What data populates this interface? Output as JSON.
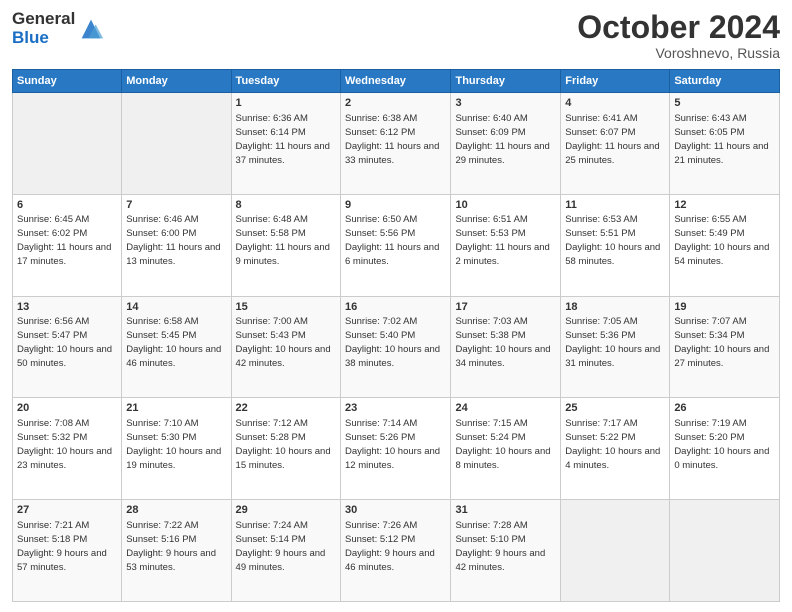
{
  "header": {
    "logo_line1": "General",
    "logo_line2": "Blue",
    "month": "October 2024",
    "location": "Voroshnevo, Russia"
  },
  "days_of_week": [
    "Sunday",
    "Monday",
    "Tuesday",
    "Wednesday",
    "Thursday",
    "Friday",
    "Saturday"
  ],
  "weeks": [
    [
      {
        "day": "",
        "sunrise": "",
        "sunset": "",
        "daylight": ""
      },
      {
        "day": "",
        "sunrise": "",
        "sunset": "",
        "daylight": ""
      },
      {
        "day": "1",
        "sunrise": "Sunrise: 6:36 AM",
        "sunset": "Sunset: 6:14 PM",
        "daylight": "Daylight: 11 hours and 37 minutes."
      },
      {
        "day": "2",
        "sunrise": "Sunrise: 6:38 AM",
        "sunset": "Sunset: 6:12 PM",
        "daylight": "Daylight: 11 hours and 33 minutes."
      },
      {
        "day": "3",
        "sunrise": "Sunrise: 6:40 AM",
        "sunset": "Sunset: 6:09 PM",
        "daylight": "Daylight: 11 hours and 29 minutes."
      },
      {
        "day": "4",
        "sunrise": "Sunrise: 6:41 AM",
        "sunset": "Sunset: 6:07 PM",
        "daylight": "Daylight: 11 hours and 25 minutes."
      },
      {
        "day": "5",
        "sunrise": "Sunrise: 6:43 AM",
        "sunset": "Sunset: 6:05 PM",
        "daylight": "Daylight: 11 hours and 21 minutes."
      }
    ],
    [
      {
        "day": "6",
        "sunrise": "Sunrise: 6:45 AM",
        "sunset": "Sunset: 6:02 PM",
        "daylight": "Daylight: 11 hours and 17 minutes."
      },
      {
        "day": "7",
        "sunrise": "Sunrise: 6:46 AM",
        "sunset": "Sunset: 6:00 PM",
        "daylight": "Daylight: 11 hours and 13 minutes."
      },
      {
        "day": "8",
        "sunrise": "Sunrise: 6:48 AM",
        "sunset": "Sunset: 5:58 PM",
        "daylight": "Daylight: 11 hours and 9 minutes."
      },
      {
        "day": "9",
        "sunrise": "Sunrise: 6:50 AM",
        "sunset": "Sunset: 5:56 PM",
        "daylight": "Daylight: 11 hours and 6 minutes."
      },
      {
        "day": "10",
        "sunrise": "Sunrise: 6:51 AM",
        "sunset": "Sunset: 5:53 PM",
        "daylight": "Daylight: 11 hours and 2 minutes."
      },
      {
        "day": "11",
        "sunrise": "Sunrise: 6:53 AM",
        "sunset": "Sunset: 5:51 PM",
        "daylight": "Daylight: 10 hours and 58 minutes."
      },
      {
        "day": "12",
        "sunrise": "Sunrise: 6:55 AM",
        "sunset": "Sunset: 5:49 PM",
        "daylight": "Daylight: 10 hours and 54 minutes."
      }
    ],
    [
      {
        "day": "13",
        "sunrise": "Sunrise: 6:56 AM",
        "sunset": "Sunset: 5:47 PM",
        "daylight": "Daylight: 10 hours and 50 minutes."
      },
      {
        "day": "14",
        "sunrise": "Sunrise: 6:58 AM",
        "sunset": "Sunset: 5:45 PM",
        "daylight": "Daylight: 10 hours and 46 minutes."
      },
      {
        "day": "15",
        "sunrise": "Sunrise: 7:00 AM",
        "sunset": "Sunset: 5:43 PM",
        "daylight": "Daylight: 10 hours and 42 minutes."
      },
      {
        "day": "16",
        "sunrise": "Sunrise: 7:02 AM",
        "sunset": "Sunset: 5:40 PM",
        "daylight": "Daylight: 10 hours and 38 minutes."
      },
      {
        "day": "17",
        "sunrise": "Sunrise: 7:03 AM",
        "sunset": "Sunset: 5:38 PM",
        "daylight": "Daylight: 10 hours and 34 minutes."
      },
      {
        "day": "18",
        "sunrise": "Sunrise: 7:05 AM",
        "sunset": "Sunset: 5:36 PM",
        "daylight": "Daylight: 10 hours and 31 minutes."
      },
      {
        "day": "19",
        "sunrise": "Sunrise: 7:07 AM",
        "sunset": "Sunset: 5:34 PM",
        "daylight": "Daylight: 10 hours and 27 minutes."
      }
    ],
    [
      {
        "day": "20",
        "sunrise": "Sunrise: 7:08 AM",
        "sunset": "Sunset: 5:32 PM",
        "daylight": "Daylight: 10 hours and 23 minutes."
      },
      {
        "day": "21",
        "sunrise": "Sunrise: 7:10 AM",
        "sunset": "Sunset: 5:30 PM",
        "daylight": "Daylight: 10 hours and 19 minutes."
      },
      {
        "day": "22",
        "sunrise": "Sunrise: 7:12 AM",
        "sunset": "Sunset: 5:28 PM",
        "daylight": "Daylight: 10 hours and 15 minutes."
      },
      {
        "day": "23",
        "sunrise": "Sunrise: 7:14 AM",
        "sunset": "Sunset: 5:26 PM",
        "daylight": "Daylight: 10 hours and 12 minutes."
      },
      {
        "day": "24",
        "sunrise": "Sunrise: 7:15 AM",
        "sunset": "Sunset: 5:24 PM",
        "daylight": "Daylight: 10 hours and 8 minutes."
      },
      {
        "day": "25",
        "sunrise": "Sunrise: 7:17 AM",
        "sunset": "Sunset: 5:22 PM",
        "daylight": "Daylight: 10 hours and 4 minutes."
      },
      {
        "day": "26",
        "sunrise": "Sunrise: 7:19 AM",
        "sunset": "Sunset: 5:20 PM",
        "daylight": "Daylight: 10 hours and 0 minutes."
      }
    ],
    [
      {
        "day": "27",
        "sunrise": "Sunrise: 7:21 AM",
        "sunset": "Sunset: 5:18 PM",
        "daylight": "Daylight: 9 hours and 57 minutes."
      },
      {
        "day": "28",
        "sunrise": "Sunrise: 7:22 AM",
        "sunset": "Sunset: 5:16 PM",
        "daylight": "Daylight: 9 hours and 53 minutes."
      },
      {
        "day": "29",
        "sunrise": "Sunrise: 7:24 AM",
        "sunset": "Sunset: 5:14 PM",
        "daylight": "Daylight: 9 hours and 49 minutes."
      },
      {
        "day": "30",
        "sunrise": "Sunrise: 7:26 AM",
        "sunset": "Sunset: 5:12 PM",
        "daylight": "Daylight: 9 hours and 46 minutes."
      },
      {
        "day": "31",
        "sunrise": "Sunrise: 7:28 AM",
        "sunset": "Sunset: 5:10 PM",
        "daylight": "Daylight: 9 hours and 42 minutes."
      },
      {
        "day": "",
        "sunrise": "",
        "sunset": "",
        "daylight": ""
      },
      {
        "day": "",
        "sunrise": "",
        "sunset": "",
        "daylight": ""
      }
    ]
  ]
}
